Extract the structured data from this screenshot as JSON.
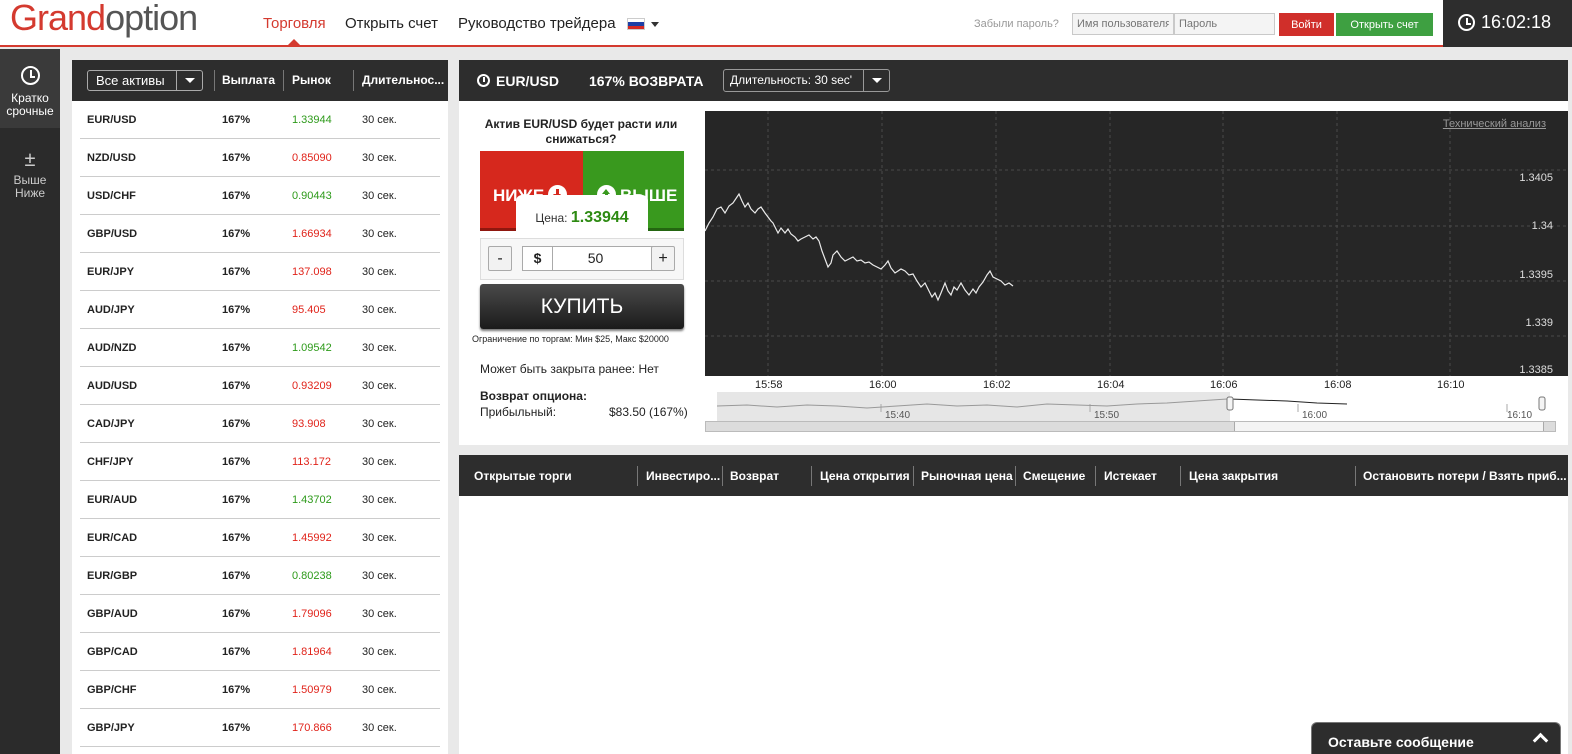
{
  "header": {
    "logo_part1": "Grand",
    "logo_part2": "option",
    "nav": [
      "Торговля",
      "Открыть счет",
      "Руководство трейдера"
    ],
    "forgot": "Забыли пароль?",
    "username_placeholder": "Имя пользователя",
    "password_placeholder": "Пароль",
    "login_button": "Войти",
    "open_account_button": "Открыть счет",
    "clock": "16:02:18"
  },
  "sidebar": {
    "items": [
      {
        "label": "Кратко срочные",
        "icon": "clock-icon"
      },
      {
        "label": "Выше Ниже",
        "icon": "plus-minus-icon"
      }
    ]
  },
  "assets": {
    "filter": "Все активы",
    "columns": [
      "Выплата",
      "Рынок",
      "Длительнос..."
    ],
    "rows": [
      {
        "name": "EUR/USD",
        "payout": "167%",
        "market": "1.33944",
        "trend": "up",
        "duration": "30 сек."
      },
      {
        "name": "NZD/USD",
        "payout": "167%",
        "market": "0.85090",
        "trend": "down",
        "duration": "30 сек."
      },
      {
        "name": "USD/CHF",
        "payout": "167%",
        "market": "0.90443",
        "trend": "up",
        "duration": "30 сек."
      },
      {
        "name": "GBP/USD",
        "payout": "167%",
        "market": "1.66934",
        "trend": "down",
        "duration": "30 сек."
      },
      {
        "name": "EUR/JPY",
        "payout": "167%",
        "market": "137.098",
        "trend": "down",
        "duration": "30 сек."
      },
      {
        "name": "AUD/JPY",
        "payout": "167%",
        "market": "95.405",
        "trend": "down",
        "duration": "30 сек."
      },
      {
        "name": "AUD/NZD",
        "payout": "167%",
        "market": "1.09542",
        "trend": "up",
        "duration": "30 сек."
      },
      {
        "name": "AUD/USD",
        "payout": "167%",
        "market": "0.93209",
        "trend": "down",
        "duration": "30 сек."
      },
      {
        "name": "CAD/JPY",
        "payout": "167%",
        "market": "93.908",
        "trend": "down",
        "duration": "30 сек."
      },
      {
        "name": "CHF/JPY",
        "payout": "167%",
        "market": "113.172",
        "trend": "down",
        "duration": "30 сек."
      },
      {
        "name": "EUR/AUD",
        "payout": "167%",
        "market": "1.43702",
        "trend": "up",
        "duration": "30 сек."
      },
      {
        "name": "EUR/CAD",
        "payout": "167%",
        "market": "1.45992",
        "trend": "down",
        "duration": "30 сек."
      },
      {
        "name": "EUR/GBP",
        "payout": "167%",
        "market": "0.80238",
        "trend": "up",
        "duration": "30 сек."
      },
      {
        "name": "GBP/AUD",
        "payout": "167%",
        "market": "1.79096",
        "trend": "down",
        "duration": "30 сек."
      },
      {
        "name": "GBP/CAD",
        "payout": "167%",
        "market": "1.81964",
        "trend": "down",
        "duration": "30 сек."
      },
      {
        "name": "GBP/CHF",
        "payout": "167%",
        "market": "1.50979",
        "trend": "down",
        "duration": "30 сек."
      },
      {
        "name": "GBP/JPY",
        "payout": "167%",
        "market": "170.866",
        "trend": "down",
        "duration": "30 сек."
      }
    ]
  },
  "trade": {
    "asset": "EUR/USD",
    "return_label": "167% ВОЗВРАТА",
    "duration": "Длительность: 30 sec'",
    "question": "Актив EUR/USD будет расти или снижаться?",
    "lower": "НИЖЕ",
    "higher": "ВЫШЕ",
    "price_label": "Цена:",
    "price": "1.33944",
    "minus": "-",
    "plus": "+",
    "currency": "$",
    "amount": "50",
    "buy": "КУПИТЬ",
    "limit": "Ограничение по торгам: Мин $25, Макс $20000",
    "closable": "Может быть закрыта ранее: Нет",
    "return_title": "Возврат опциона:",
    "profit_label": "Прибыльный:",
    "profit_value": "$83.50 (167%)"
  },
  "chart": {
    "tech_link": "Технический анализ",
    "y_ticks": [
      "1.3405",
      "1.34",
      "1.3395",
      "1.339",
      "1.3385"
    ],
    "x_ticks": [
      "15:58",
      "16:00",
      "16:02",
      "16:04",
      "16:06",
      "16:08",
      "16:10"
    ],
    "navigator_ticks": [
      "15:40",
      "15:50",
      "16:00",
      "16:10"
    ]
  },
  "open_trades": {
    "columns": [
      "Открытые торги",
      "Инвестиро...",
      "Возврат",
      "Цена открытия",
      "Рыночная цена",
      "Смещение",
      "Истекает",
      "Цена закрытия",
      "Остановить потери / Взять приб..."
    ]
  },
  "chat": {
    "label": "Оставьте сообщение"
  },
  "colors": {
    "accent": "#d43a2f",
    "up": "#2d9a1a",
    "down": "#e0231a",
    "dark": "#2d2d2d"
  }
}
